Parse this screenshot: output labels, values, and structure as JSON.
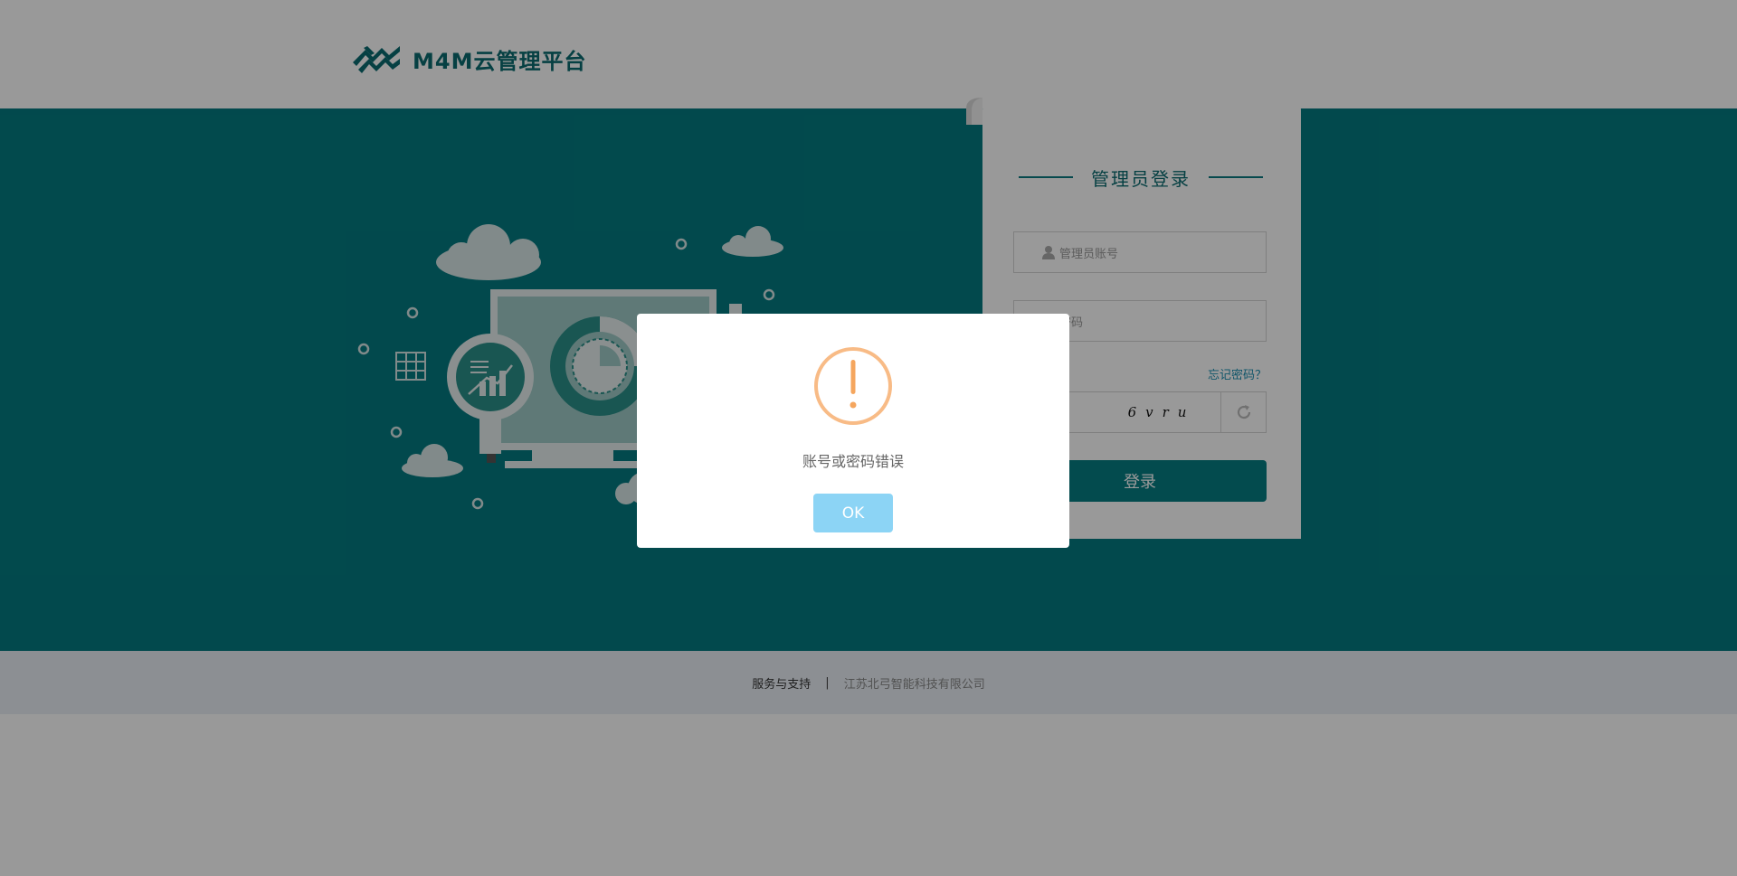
{
  "header": {
    "brand_name": "M4M云管理平台",
    "logo_icon": "zigzag-leaf-logo"
  },
  "login": {
    "title": "管理员登录",
    "username_placeholder": "管理员账号",
    "password_placeholder": "密码",
    "forgot_link": "忘记密码？",
    "captcha_text": "6vru",
    "login_button": "登录"
  },
  "footer": {
    "support_label": "服务与支持",
    "separator": "|",
    "company": "江苏北弓智能科技有限公司"
  },
  "modal": {
    "message": "账号或密码错误",
    "ok_button": "OK",
    "icon": "warning-icon"
  },
  "colors": {
    "brand_teal": "#047b81",
    "header_bg": "#ffffff",
    "footer_bg": "#e9eff5",
    "warning_orange": "#f8bb86",
    "ok_button": "#8cd4f5",
    "link_blue": "#1c8fb1"
  }
}
